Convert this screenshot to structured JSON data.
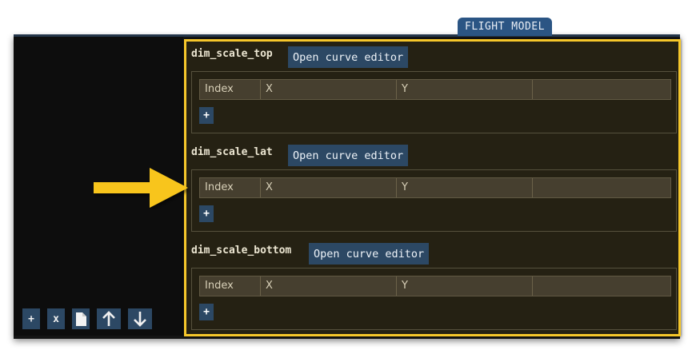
{
  "tab": {
    "label": "FLIGHT MODEL"
  },
  "left_toolbar": {
    "add_label": "+",
    "remove_label": "x",
    "icons": [
      "document-icon",
      "arrow-up-icon",
      "arrow-down-icon"
    ]
  },
  "curves": [
    {
      "name": "dim_scale_top",
      "button_label": "Open curve editor",
      "columns": [
        "Index",
        "X",
        "Y",
        ""
      ],
      "add_label": "+"
    },
    {
      "name": "dim_scale_lat",
      "button_label": "Open curve editor",
      "columns": [
        "Index",
        "X",
        "Y",
        ""
      ],
      "add_label": "+"
    },
    {
      "name": "dim_scale_bottom",
      "button_label": "Open curve editor",
      "columns": [
        "Index",
        "X",
        "Y",
        ""
      ],
      "add_label": "+"
    }
  ],
  "colors": {
    "highlight": "#f6c72b",
    "button": "#2c4864",
    "tab": "#2b5584",
    "panel_bg": "#252113"
  }
}
